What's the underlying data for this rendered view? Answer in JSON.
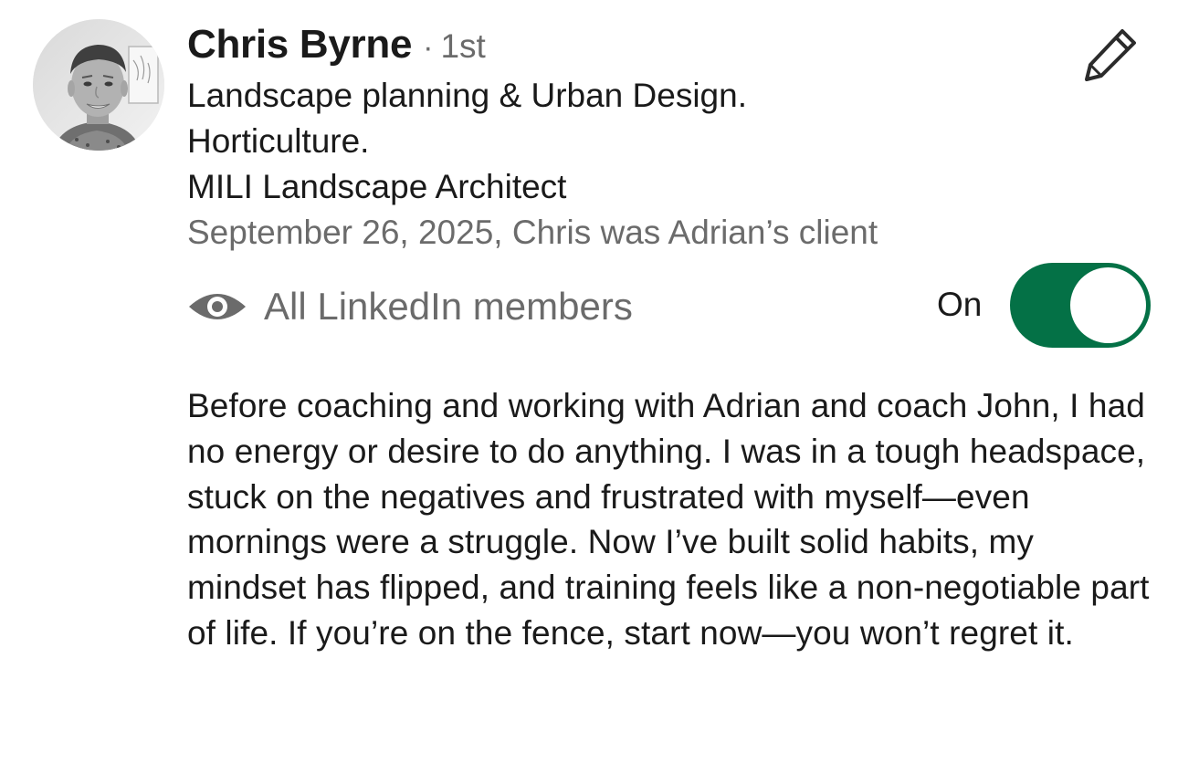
{
  "recommendation": {
    "author": {
      "name": "Chris Byrne",
      "separator": "·",
      "degree": "1st",
      "headline_lines": [
        "Landscape planning & Urban Design.",
        "Horticulture.",
        "MILI Landscape Architect"
      ],
      "relationship": "September 26, 2025, Chris was Adrian’s client",
      "avatar_icon": "profile-photo"
    },
    "edit_icon": "pencil-icon",
    "visibility": {
      "icon": "eye-icon",
      "label": "All LinkedIn members",
      "toggle_label": "On",
      "toggle_on": true,
      "toggle_color": "#047146"
    },
    "text": "Before coaching and working with Adrian and coach John, I had no energy or desire to do anything. I was in a tough headspace, stuck on the negatives and frustrated with myself—even mornings were a struggle. Now I’ve built solid habits, my mindset has flipped, and training feels like a non-negotiable part of life. If you’re on the fence, start now—you won’t regret it."
  }
}
